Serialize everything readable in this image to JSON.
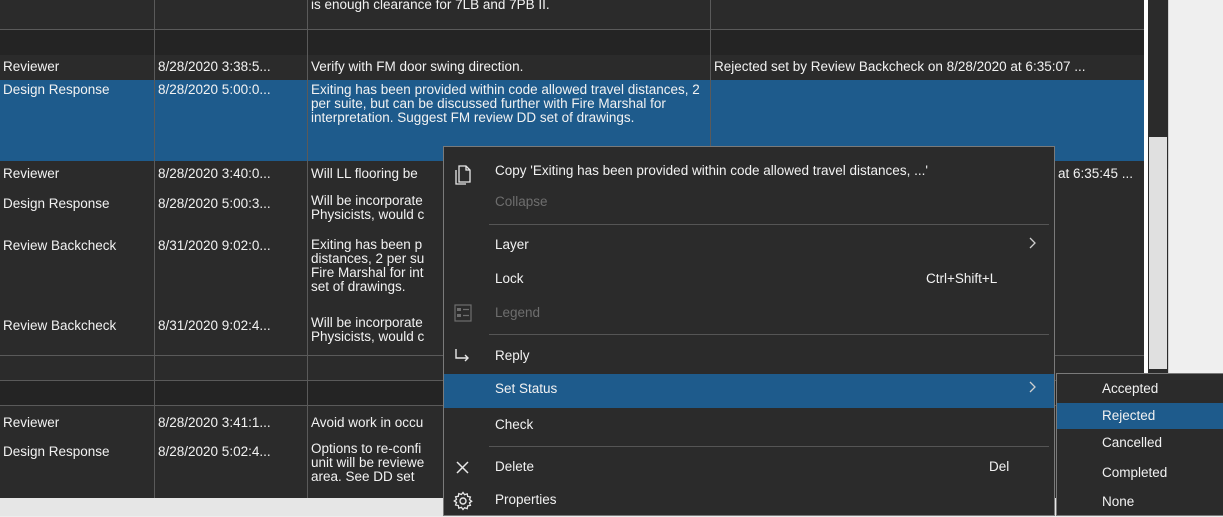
{
  "grid": {
    "rows": [
      {
        "col1": "",
        "col2": "",
        "col3": "is enough clearance for 7LB and 7PB II.",
        "col4": ""
      },
      {
        "col1": "Reviewer",
        "col2": "8/28/2020 3:38:5...",
        "col3": "Verify with FM door swing direction.",
        "col4": "Rejected set by Review Backcheck on 8/28/2020 at 6:35:07 ..."
      },
      {
        "col1": "Design Response",
        "col2": "8/28/2020 5:00:0...",
        "col3": "Exiting has been provided within code allowed travel distances, 2 per suite, but can be discussed further with Fire Marshal for interpretation. Suggest FM review DD set of drawings.",
        "col4": ""
      },
      {
        "col1": "Reviewer",
        "col2": "8/28/2020 3:40:0...",
        "col3": "Will LL flooring be",
        "col4": "at 6:35:45 ..."
      },
      {
        "col1": "Design Response",
        "col2": "8/28/2020 5:00:3...",
        "col3": "Will be incorporate Physicists, would c",
        "col4": ""
      },
      {
        "col1": "Review Backcheck",
        "col2": "8/31/2020 9:02:0...",
        "col3": "Exiting has been p distances, 2 per su Fire Marshal for int set of drawings.",
        "col4": ""
      },
      {
        "col1": "Review Backcheck",
        "col2": "8/31/2020 9:02:4...",
        "col3": "Will be incorporate Physicists, would c",
        "col4": ""
      },
      {
        "col1": "",
        "col2": "",
        "col3": "",
        "col4": ""
      },
      {
        "col1": "",
        "col2": "",
        "col3": "",
        "col4": ""
      },
      {
        "col1": "Reviewer",
        "col2": "8/28/2020 3:41:1...",
        "col3": "Avoid work in occu",
        "col4": ""
      },
      {
        "col1": "Design Response",
        "col2": "8/28/2020 5:02:4...",
        "col3": "Options to re-confi unit will be reviewe area. See DD set",
        "col4": ""
      }
    ]
  },
  "context_menu": {
    "copy": "Copy 'Exiting has been provided within code allowed travel distances, ...'",
    "collapse": "Collapse",
    "layer": "Layer",
    "lock": "Lock",
    "lock_shortcut": "Ctrl+Shift+L",
    "legend": "Legend",
    "reply": "Reply",
    "set_status": "Set Status",
    "check": "Check",
    "delete": "Delete",
    "delete_shortcut": "Del",
    "properties": "Properties",
    "submenu_arrow": ">"
  },
  "status_submenu": [
    "Accepted",
    "Rejected",
    "Cancelled",
    "Completed",
    "None"
  ],
  "colors": {
    "background": "#2b2b2b",
    "selection": "#1e5b8c",
    "grid_lines": "#5a5a5a",
    "text": "#f2f2f2",
    "disabled_text": "#6e6e6e"
  },
  "icons": {
    "copy": "copy-icon",
    "legend": "legend-icon",
    "reply": "reply-icon",
    "delete": "close-icon",
    "properties": "gear-icon",
    "submenu": "chevron-right-icon"
  }
}
